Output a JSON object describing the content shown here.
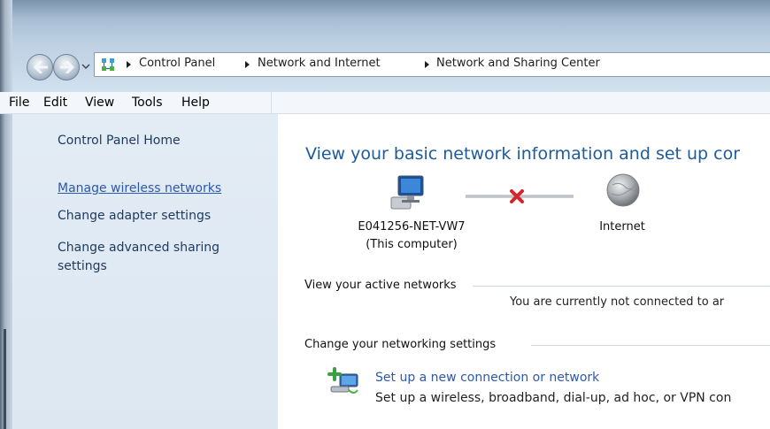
{
  "breadcrumb": {
    "items": [
      "Control Panel",
      "Network and Internet",
      "Network and Sharing Center"
    ]
  },
  "menu": {
    "items": [
      "File",
      "Edit",
      "View",
      "Tools",
      "Help"
    ]
  },
  "sidebar": {
    "home": "Control Panel Home",
    "links": [
      "Manage wireless networks",
      "Change adapter settings",
      "Change advanced sharing settings"
    ]
  },
  "main": {
    "heading": "View your basic network information and set up cor",
    "computer_name": "E041256-NET-VW7",
    "computer_sub": "(This computer)",
    "internet_label": "Internet",
    "active_networks_label": "View your active networks",
    "not_connected_text": "You are currently not connected to ar",
    "change_settings_label": "Change your networking settings",
    "setup_link": "Set up a new connection or network",
    "setup_desc": "Set up a wireless, broadband, dial-up, ad hoc, or VPN con"
  },
  "colors": {
    "link": "#2d58b0",
    "heading": "#1e5b9c",
    "sidebar_bg": "#dce7f2",
    "error_x": "#d4262a"
  },
  "icons": {
    "back": "back-arrow-icon",
    "forward": "forward-arrow-icon",
    "network": "network-icon",
    "computer": "computer-icon",
    "disconnected": "red-x-icon",
    "internet": "globe-icon",
    "setup": "new-connection-icon"
  }
}
